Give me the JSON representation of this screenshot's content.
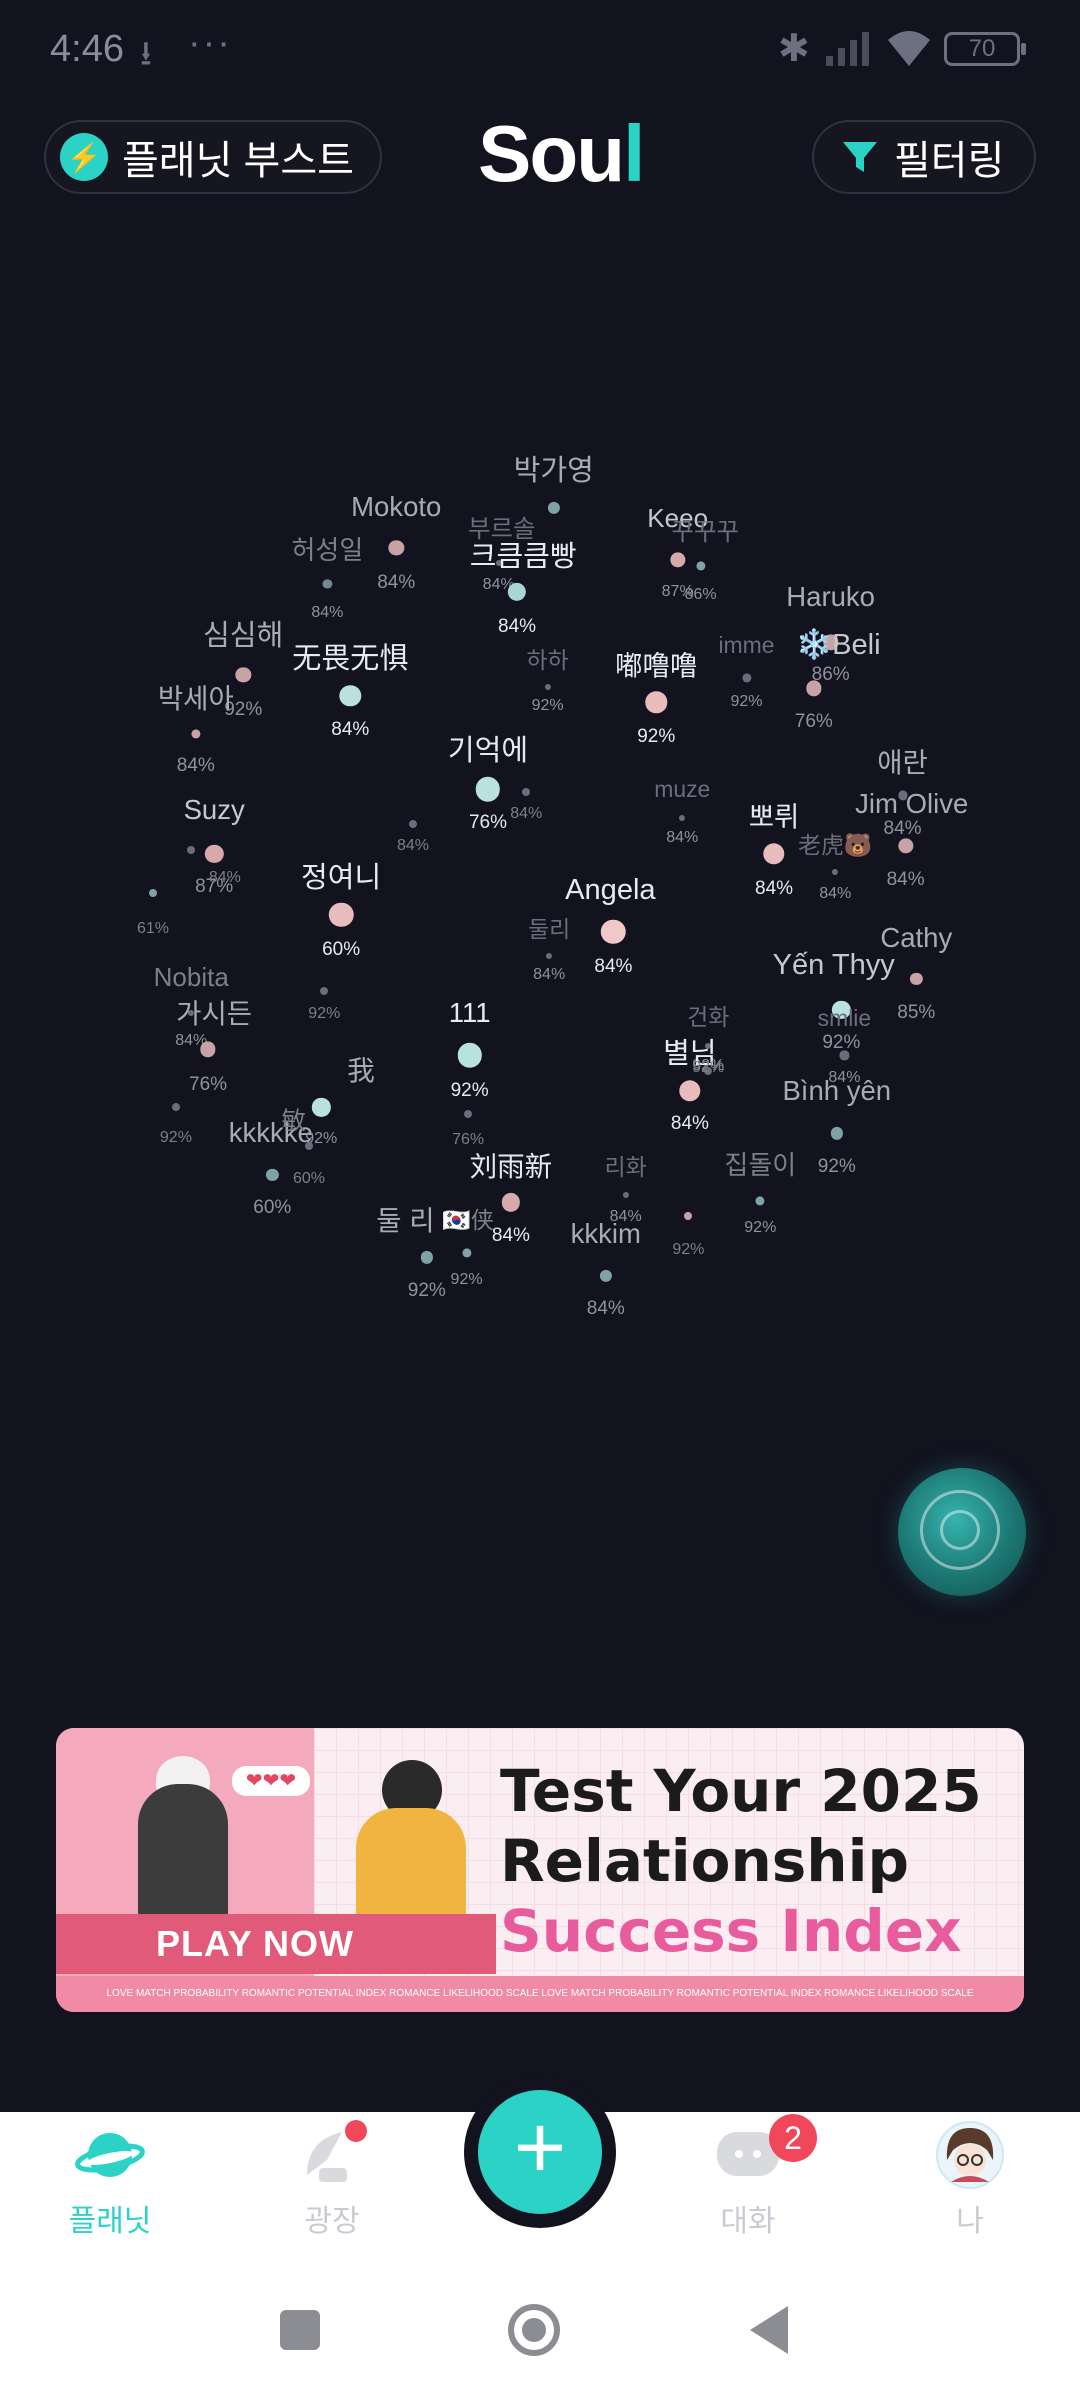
{
  "status_bar": {
    "time": "4:46",
    "download_glyph": "⭳",
    "more_glyph": "···",
    "bluetooth_glyph": "✱",
    "battery": "70"
  },
  "header": {
    "boost_icon": "⚡",
    "boost_label": "플래닛 부스트",
    "logo_main": "Sou",
    "logo_accent": "l",
    "filter_label": "필터링",
    "accent_color": "#2ad3c6"
  },
  "planet": {
    "stars": [
      {
        "name": "박가영",
        "pct": ""
      },
      {
        "name": "Mokoto",
        "pct": "84%"
      },
      {
        "name": "허성일",
        "pct": "84%"
      },
      {
        "name": "부르솔",
        "pct": "84%"
      },
      {
        "name": "크큼큼빵",
        "pct": "84%"
      },
      {
        "name": "Keeo",
        "pct": "87%"
      },
      {
        "name": "꾸꾸꾸",
        "pct": "86%"
      },
      {
        "name": "심심해",
        "pct": "92%"
      },
      {
        "name": "无畏无惧",
        "pct": "84%"
      },
      {
        "name": "하하",
        "pct": "92%"
      },
      {
        "name": "嘟噜噜",
        "pct": "92%"
      },
      {
        "name": "imme",
        "pct": "92%"
      },
      {
        "name": "Haruko",
        "pct": "86%"
      },
      {
        "name": "❄️Beli",
        "pct": "76%"
      },
      {
        "name": "박세아",
        "pct": "84%"
      },
      {
        "name": "기억에",
        "pct": "76%"
      },
      {
        "name": "muze",
        "pct": "84%"
      },
      {
        "name": "애란",
        "pct": "84%"
      },
      {
        "name": "Suzy",
        "pct": "87%"
      },
      {
        "name": "뽀뤼",
        "pct": "84%"
      },
      {
        "name": "Jim Olive",
        "pct": "84%"
      },
      {
        "name": "老虎🐻",
        "pct": "84%"
      },
      {
        "name": "정여니",
        "pct": "60%"
      },
      {
        "name": "Angela",
        "pct": "84%"
      },
      {
        "name": "둘리",
        "pct": "84%"
      },
      {
        "name": "Cathy",
        "pct": "85%"
      },
      {
        "name": "Nobita",
        "pct": "84%"
      },
      {
        "name": "Yến Thyy",
        "pct": "92%"
      },
      {
        "name": "가시든",
        "pct": "76%"
      },
      {
        "name": "111",
        "pct": "92%"
      },
      {
        "name": "건화",
        "pct": "92%"
      },
      {
        "name": "별님",
        "pct": "84%"
      },
      {
        "name": "smlie",
        "pct": "84%"
      },
      {
        "name": "我",
        "pct": ""
      },
      {
        "name": "Bình yên",
        "pct": "92%"
      },
      {
        "name": "kkkkke",
        "pct": "60%"
      },
      {
        "name": "敏",
        "pct": "92%"
      },
      {
        "name": "刘雨新",
        "pct": "84%"
      },
      {
        "name": "리화",
        "pct": "84%"
      },
      {
        "name": "집돌이",
        "pct": "92%"
      },
      {
        "name": "둘 리",
        "pct": "92%"
      },
      {
        "name": "🇰🇷侠",
        "pct": "92%"
      },
      {
        "name": "kkkim",
        "pct": "84%"
      }
    ],
    "extra_pcts": [
      "61%",
      "92%",
      "84%",
      "84%",
      "84%",
      "92%",
      "76%",
      "92%",
      "92%",
      "60%"
    ]
  },
  "banner": {
    "line1": "Test Your 2025",
    "line2": "Relationship",
    "line3": "Success Index",
    "cta": "PLAY NOW",
    "strip": "LOVE MATCH PROBABILITY ROMANTIC POTENTIAL INDEX ROMANCE LIKELIHOOD SCALE LOVE MATCH PROBABILITY ROMANTIC POTENTIAL INDEX ROMANCE LIKELIHOOD SCALE",
    "hearts": "❤❤❤"
  },
  "nav": {
    "planet": "플래닛",
    "square": "광장",
    "fab_symbol": "+",
    "chat": "대화",
    "chat_badge": "2",
    "me": "나"
  }
}
